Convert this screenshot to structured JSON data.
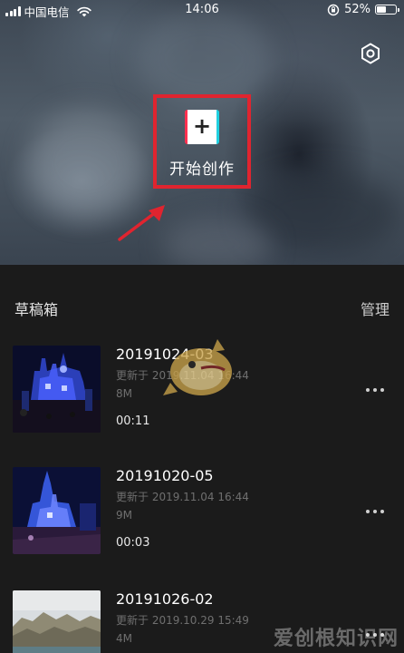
{
  "status_bar": {
    "carrier": "中国电信",
    "time": "14:06",
    "battery": "52%",
    "battery_level": 0.52
  },
  "hero": {
    "create_button_label": "开始创作",
    "plus_symbol": "+",
    "settings_icon": "gear-icon"
  },
  "drafts": {
    "title": "草稿箱",
    "manage_label": "管理",
    "items": [
      {
        "title": "20191024-03",
        "updated": "更新于 2019.11.04 16:44",
        "size": "8M",
        "duration": "00:11"
      },
      {
        "title": "20191020-05",
        "updated": "更新于 2019.11.04 16:44",
        "size": "9M",
        "duration": "00:03"
      },
      {
        "title": "20191026-02",
        "updated": "更新于 2019.10.29 15:49",
        "size": "4M",
        "duration": ""
      }
    ]
  },
  "watermark": "爱创根知识网",
  "colors": {
    "highlight_box": "#e0242f",
    "background": "#1b1b1b"
  }
}
